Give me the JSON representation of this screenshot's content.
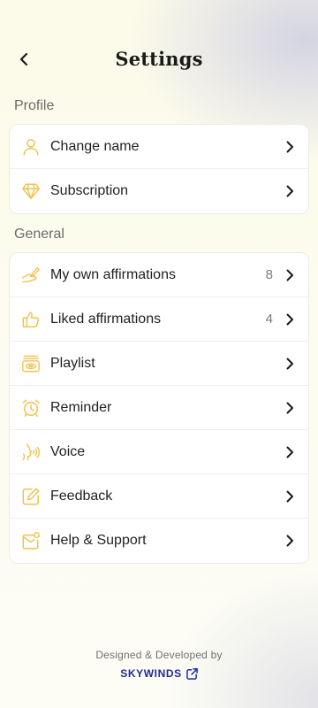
{
  "header": {
    "back_icon": "chevron-left-icon",
    "title": "Settings"
  },
  "sections": [
    {
      "label": "Profile",
      "items": [
        {
          "label": "Change name",
          "icon": "user-icon",
          "count": ""
        },
        {
          "label": "Subscription",
          "icon": "diamond-icon",
          "count": ""
        }
      ]
    },
    {
      "label": "General",
      "items": [
        {
          "label": "My own affirmations",
          "icon": "writing-hand-icon",
          "count": "8"
        },
        {
          "label": "Liked affirmations",
          "icon": "thumbs-up-icon",
          "count": "4"
        },
        {
          "label": "Playlist",
          "icon": "playlist-icon",
          "count": ""
        },
        {
          "label": "Reminder",
          "icon": "alarm-clock-icon",
          "count": ""
        },
        {
          "label": "Voice",
          "icon": "voice-icon",
          "count": ""
        },
        {
          "label": "Feedback",
          "icon": "edit-icon",
          "count": ""
        },
        {
          "label": "Help & Support",
          "icon": "mail-icon",
          "count": ""
        }
      ]
    }
  ],
  "footer": {
    "credit": "Designed & Developed by",
    "brand": "SKYWINDS",
    "brand_icon": "external-link-icon"
  },
  "colors": {
    "icon_accent": "#f2c24f",
    "brand": "#1f2a9c",
    "background": "#fcfbee"
  }
}
